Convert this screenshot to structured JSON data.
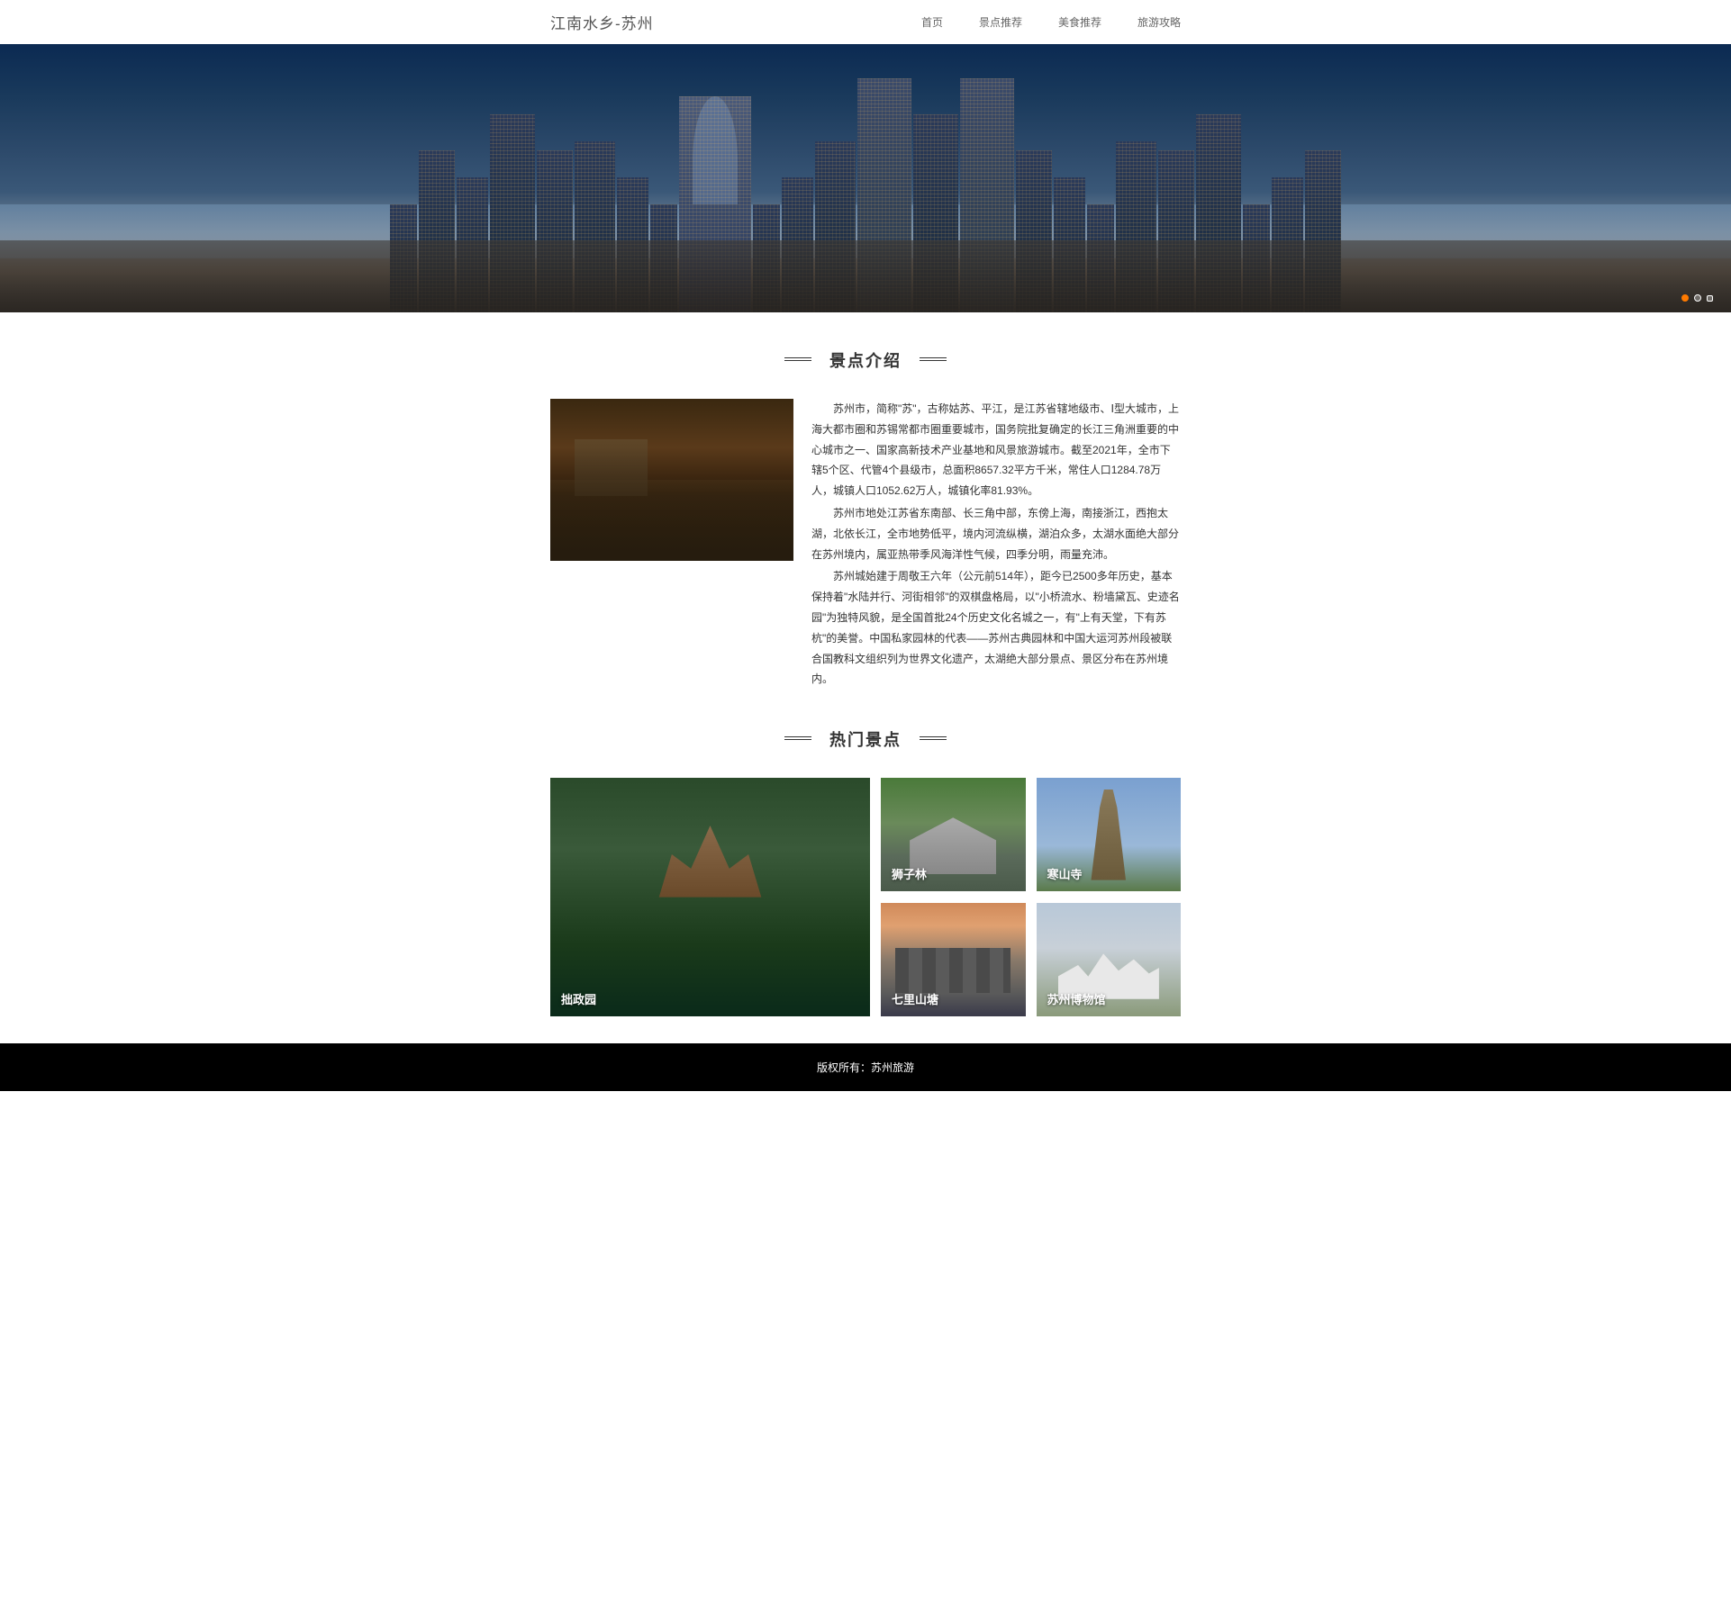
{
  "header": {
    "logo": "江南水乡-苏州",
    "nav": [
      "首页",
      "景点推荐",
      "美食推荐",
      "旅游攻略"
    ]
  },
  "section_intro_title": "景点介绍",
  "intro_paragraphs": [
    "苏州市，简称\"苏\"，古称姑苏、平江，是江苏省辖地级市、Ⅰ型大城市，上海大都市圈和苏锡常都市圈重要城市，国务院批复确定的长江三角洲重要的中心城市之一、国家高新技术产业基地和风景旅游城市。截至2021年，全市下辖5个区、代管4个县级市，总面积8657.32平方千米，常住人口1284.78万人，城镇人口1052.62万人，城镇化率81.93%。",
    "苏州市地处江苏省东南部、长三角中部，东傍上海，南接浙江，西抱太湖，北依长江，全市地势低平，境内河流纵横，湖泊众多，太湖水面绝大部分在苏州境内，属亚热带季风海洋性气候，四季分明，雨量充沛。",
    "苏州城始建于周敬王六年（公元前514年），距今已2500多年历史，基本保持着\"水陆并行、河街相邻\"的双棋盘格局，以\"小桥流水、粉墙黛瓦、史迹名园\"为独特风貌，是全国首批24个历史文化名城之一，有\"上有天堂，下有苏杭\"的美誉。中国私家园林的代表——苏州古典园林和中国大运河苏州段被联合国教科文组织列为世界文化遗产，太湖绝大部分景点、景区分布在苏州境内。"
  ],
  "section_hot_title": "热门景点",
  "attractions": {
    "big": "拙政园",
    "small": [
      "狮子林",
      "寒山寺",
      "七里山塘",
      "苏州博物馆"
    ]
  },
  "footer": "版权所有：苏州旅游"
}
